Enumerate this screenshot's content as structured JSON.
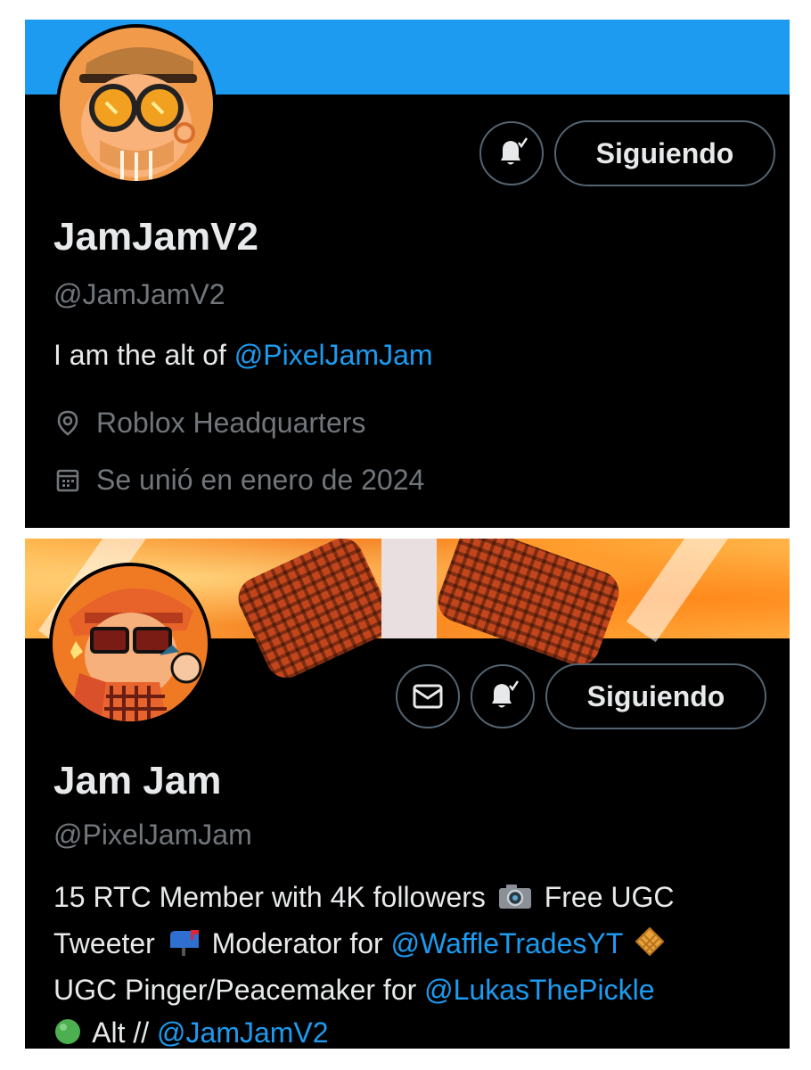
{
  "profile_alt": {
    "display_name": "JamJamV2",
    "handle": "@JamJamV2",
    "bio_text": "I am the alt of ",
    "bio_mention": "@PixelJamJam",
    "location": "Roblox Headquarters",
    "joined": "Se unió en enero de 2024",
    "follow_label": "Siguiendo",
    "banner_color": "#1d9bf0"
  },
  "profile_main": {
    "display_name": "Jam Jam",
    "handle": "@PixelJamJam",
    "follow_label": "Siguiendo",
    "bio": {
      "line1_text": "15 RTC Member with 4K followers",
      "line1_after": "Free UGC",
      "line2_text": "Tweeter",
      "line2_mid": "Moderator for ",
      "line2_mention": "@WaffleTradesYT",
      "line3_text": "UGC Pinger/Peacemaker for ",
      "line3_mention": "@LukasThePickle",
      "line4_text": "Alt // ",
      "line4_mention": "@JamJamV2"
    }
  },
  "icons": {
    "bell": "bell-check-icon",
    "mail": "envelope-icon",
    "location": "location-pin-icon",
    "calendar": "calendar-icon",
    "camera": "camera-emoji",
    "mailbox": "mailbox-emoji",
    "waffle": "waffle-emoji",
    "green_circle": "green-circle-emoji"
  },
  "colors": {
    "background": "#000000",
    "text_primary": "#e7e9ea",
    "text_secondary": "#71767b",
    "link": "#1d9bf0",
    "border": "#536471"
  }
}
